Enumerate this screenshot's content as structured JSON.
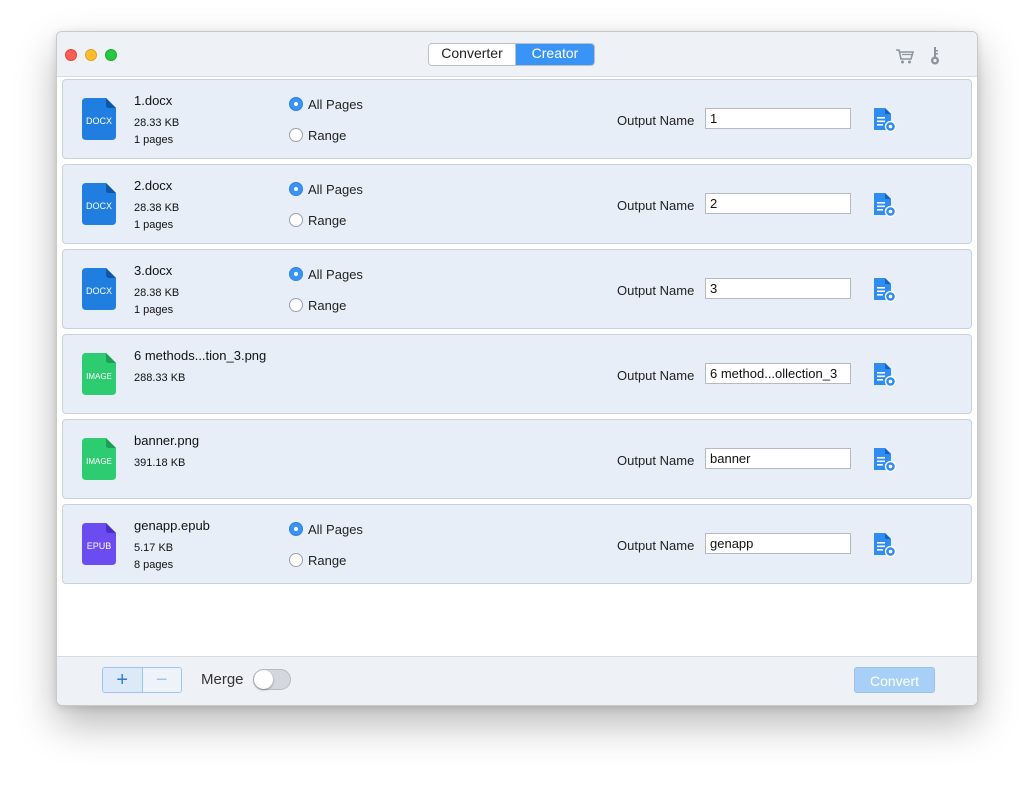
{
  "toolbar": {
    "tabs": [
      {
        "label": "Converter",
        "active": false
      },
      {
        "label": "Creator",
        "active": true
      }
    ],
    "cart_icon": "cart-icon",
    "key_icon": "key-icon"
  },
  "colors": {
    "accent": "#3a94f6",
    "docx": "#1f7ee0",
    "image": "#2ecc71",
    "epub": "#6a4cf0"
  },
  "files": [
    {
      "name": "1.docx",
      "size": "28.33 KB",
      "pages": "1 pages",
      "type_label": "DOCX",
      "page_options": [
        "All Pages",
        "Range"
      ],
      "selected": "All Pages",
      "output_label": "Output Name",
      "output_value": "1"
    },
    {
      "name": "2.docx",
      "size": "28.38 KB",
      "pages": "1 pages",
      "type_label": "DOCX",
      "page_options": [
        "All Pages",
        "Range"
      ],
      "selected": "All Pages",
      "output_label": "Output Name",
      "output_value": "2"
    },
    {
      "name": "3.docx",
      "size": "28.38 KB",
      "pages": "1 pages",
      "type_label": "DOCX",
      "page_options": [
        "All Pages",
        "Range"
      ],
      "selected": "All Pages",
      "output_label": "Output Name",
      "output_value": "3"
    },
    {
      "name": "6 methods...tion_3.png",
      "size": "288.33 KB",
      "type_label": "IMAGE",
      "output_label": "Output Name",
      "output_value": "6 method...ollection_3"
    },
    {
      "name": "banner.png",
      "size": "391.18 KB",
      "type_label": "IMAGE",
      "output_label": "Output Name",
      "output_value": "banner"
    },
    {
      "name": "genapp.epub",
      "size": "5.17 KB",
      "pages": "8 pages",
      "type_label": "EPUB",
      "page_options": [
        "All Pages",
        "Range"
      ],
      "selected": "All Pages",
      "output_label": "Output Name",
      "output_value": "genapp"
    }
  ],
  "footer": {
    "add_label": "+",
    "remove_label": "−",
    "merge_label": "Merge",
    "merge_enabled": false,
    "convert_label": "Convert"
  }
}
